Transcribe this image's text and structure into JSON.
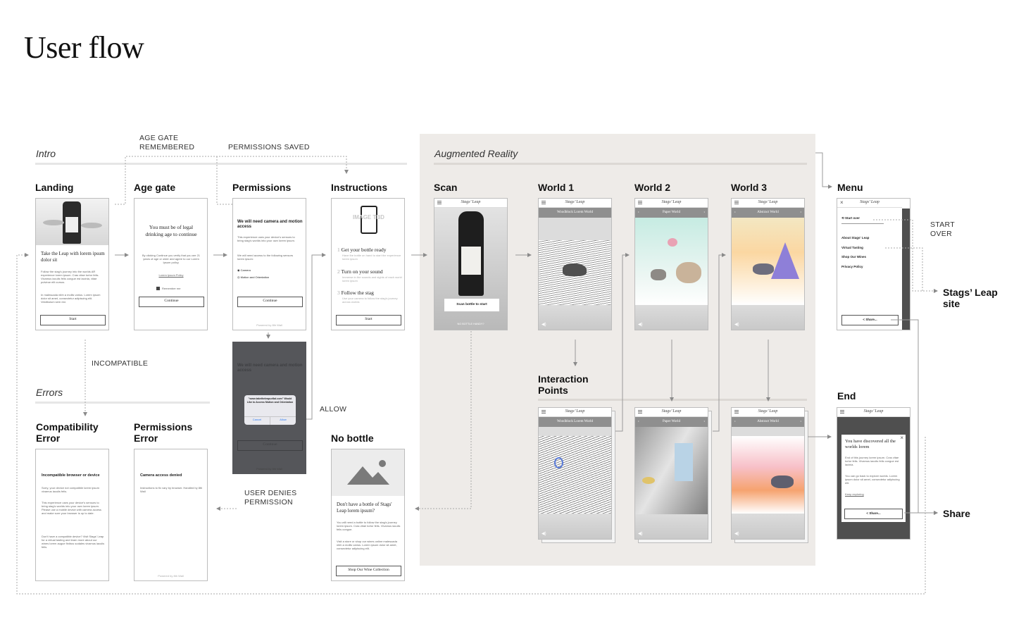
{
  "title": "User flow",
  "sections": {
    "intro": "Intro",
    "errors": "Errors",
    "ar": "Augmented Reality"
  },
  "notes": {
    "age_gate_remembered_1": "AGE GATE",
    "age_gate_remembered_2": "REMEMBERED",
    "permissions_saved": "PERMISSIONS SAVED",
    "incompatible": "INCOMPATIBLE",
    "allow": "ALLOW",
    "user_denies_1": "USER DENIES",
    "user_denies_2": "PERMISSION",
    "start_over_1": "START",
    "start_over_2": "OVER"
  },
  "screen_labels": {
    "landing": "Landing",
    "age_gate": "Age gate",
    "permissions": "Permissions",
    "instructions": "Instructions",
    "scan": "Scan",
    "world1": "World 1",
    "world2": "World 2",
    "world3": "World 3",
    "menu": "Menu",
    "compat_error_1": "Compatibility",
    "compat_error_2": "Error",
    "perm_error_1": "Permissions",
    "perm_error_2": "Error",
    "no_bottle": "No bottle",
    "interaction_1": "Interaction",
    "interaction_2": "Points",
    "end": "End"
  },
  "external": {
    "stags_1": "Stags’ Leap",
    "stags_2": "site",
    "share": "Share"
  },
  "brand": "Stags’ Leap",
  "landing": {
    "headline": "Take the Leap with lorem ipsum dolor sit",
    "body": "Follow the stag's journey into the worlds AR experience lorem ipsum. Cras vitae tortor felis. Vivamus iaculis felis congue est lacinia, vitae pulvinar elit cursus.",
    "body2": "In malesuada nibh a mollis varius. Lorem ipsum dolor sit amet, consectetur adipiscing elit. Vestibulum sem est.",
    "button": "Start"
  },
  "age_gate": {
    "headline": "You must be of legal drinking age to continue",
    "body": "By clicking Continue you verify that you are 21 years of age or older and agree to our Lorem Ipsum policy.",
    "link": "Lorem Ipsum Policy",
    "remember": "Remember me",
    "button": "Continue"
  },
  "permissions": {
    "headline": "We will need camera and motion access",
    "body": "This experience uses your device's sensors to bring stag's worlds into your own lorem ipsum.",
    "body2": "We will need access to the following sensors lorem ipsum:",
    "item1": "Camera",
    "item2": "Motion and Orientation",
    "button": "Continue",
    "footer": "Powered by 8th Wall"
  },
  "dialog": {
    "text": "\"www.taketheleapurlbd.com\" Would Like to Access Motion and Orientation",
    "cancel": "Cancel",
    "allow": "Allow"
  },
  "instructions": {
    "image_placeholder": "IMAGE TBD",
    "step1": "Get your bottle ready",
    "step1_body": "Have the bottle on hand to start the experience lorem ipsum",
    "step2": "Turn on your sound",
    "step2_body": "Immerse in the sounds and sights of each world lorem ipsum",
    "step3": "Follow the stag",
    "step3_body": "Use your camera to follow the stag's journey across worlds",
    "button": "Start"
  },
  "scan": {
    "button": "Scan bottle to start",
    "sub": "NO BOTTLE HANDY?"
  },
  "worlds": {
    "w1": "Woodblock Lorem World",
    "w2": "Paper World",
    "w3": "Abstract World"
  },
  "menu": {
    "start_over": "Start over",
    "items": [
      "About Stags' Leap",
      "Virtual Tasting",
      "Shop Our Wines",
      "Privacy Policy"
    ],
    "share": "Share..."
  },
  "compat_error": {
    "headline": "Incompatible browser or device",
    "body": "Sorry, your device not compatible lorem ipsum vivamus iaculis felis.",
    "body2": "This experience uses your device's sensors to bring stag's worlds into your own lorem ipsum. Please use a mobile device with camera access and make sure your browser is up to date.",
    "body3": "Don't have a compatible device? Visit Stags' Leap for a virtual tasting and learn more about our wines lorem augue finibus sodales vivamus iaculis felis."
  },
  "perm_error": {
    "headline": "Camera access denied",
    "body": "Instructions to fix vary by browser. Handled by 8th Wall",
    "footer": "Powered by 8th Wall"
  },
  "no_bottle": {
    "headline": "Don't have a bottle of Stags' Leap lorem ipsum?",
    "body": "You will need a bottle to follow the stag's journey lorem ipsum. Cras vitae tortor felis. Vivamus iaculis felis congue.",
    "body2": "Visit a store or shop our wines online malesuada nibh a mollis varius. Lorem ipsum dolor sit amet, consectetur adipiscing elit.",
    "button": "Shop Our Wine Collection"
  },
  "end": {
    "headline": "You have discovered all the worlds lorem",
    "body": "End of this journey lorem ipsum. Cras vitae tortor felis. Vivamus iaculis felis congue est lacinia.",
    "body2": "You can go back to explore worlds. Lorem ipsum dolor sit amet, consectetur adipiscing elit.",
    "link": "Keep exploring",
    "share": "Share..."
  }
}
